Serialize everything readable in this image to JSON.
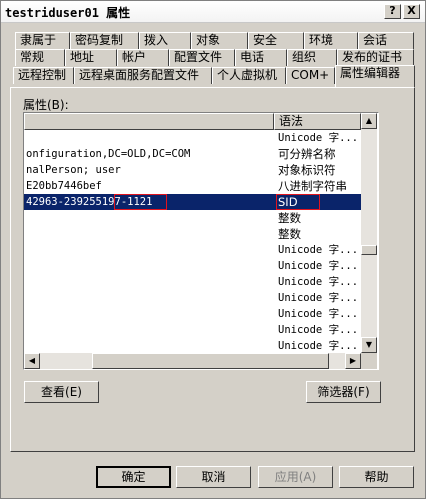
{
  "window": {
    "title": "testriduser01 属性",
    "help_glyph": "?",
    "close_glyph": "X"
  },
  "tabs": {
    "row1": [
      "隶属于",
      "密码复制",
      "拨入",
      "对象",
      "安全",
      "环境",
      "会话"
    ],
    "row2": [
      "常规",
      "地址",
      "帐户",
      "配置文件",
      "电话",
      "组织",
      "发布的证书"
    ],
    "row3": [
      "远程控制",
      "远程桌面服务配置文件",
      "个人虚拟机",
      "COM+",
      "属性编辑器"
    ],
    "active": "属性编辑器"
  },
  "attributes_label": "属性(B):",
  "list": {
    "columns": [
      "",
      "语法"
    ],
    "rows": [
      {
        "value": "",
        "syntax": "Unicode 字..."
      },
      {
        "value": "onfiguration,DC=OLD,DC=COM",
        "syntax": "可分辨名称"
      },
      {
        "value": "nalPerson; user",
        "syntax": "对象标识符"
      },
      {
        "value": "E20bb7446bef",
        "syntax": "八进制字符串"
      },
      {
        "value": "42963-239255197-1121",
        "syntax": "SID",
        "selected": true
      },
      {
        "value": "",
        "syntax": "整数"
      },
      {
        "value": "",
        "syntax": "整数"
      },
      {
        "value": "",
        "syntax": "Unicode 字..."
      },
      {
        "value": "",
        "syntax": "Unicode 字..."
      },
      {
        "value": "",
        "syntax": "Unicode 字..."
      },
      {
        "value": "",
        "syntax": "Unicode 字..."
      },
      {
        "value": "",
        "syntax": "Unicode 字..."
      },
      {
        "value": "",
        "syntax": "Unicode 字..."
      },
      {
        "value": "",
        "syntax": "Unicode 字..."
      },
      {
        "value": "",
        "syntax": "Unicode 字..."
      }
    ]
  },
  "buttons": {
    "view": "查看(E)",
    "filter": "筛选器(F)",
    "ok": "确定",
    "cancel": "取消",
    "apply": "应用(A)",
    "help": "帮助"
  },
  "icons": [
    "help-icon",
    "close-icon",
    "scroll-up-icon",
    "scroll-down-icon",
    "scroll-left-icon",
    "scroll-right-icon"
  ],
  "colors": {
    "selection": "#0a246a",
    "highlight_box": "#e0141e",
    "face": "#d4d0c8"
  }
}
